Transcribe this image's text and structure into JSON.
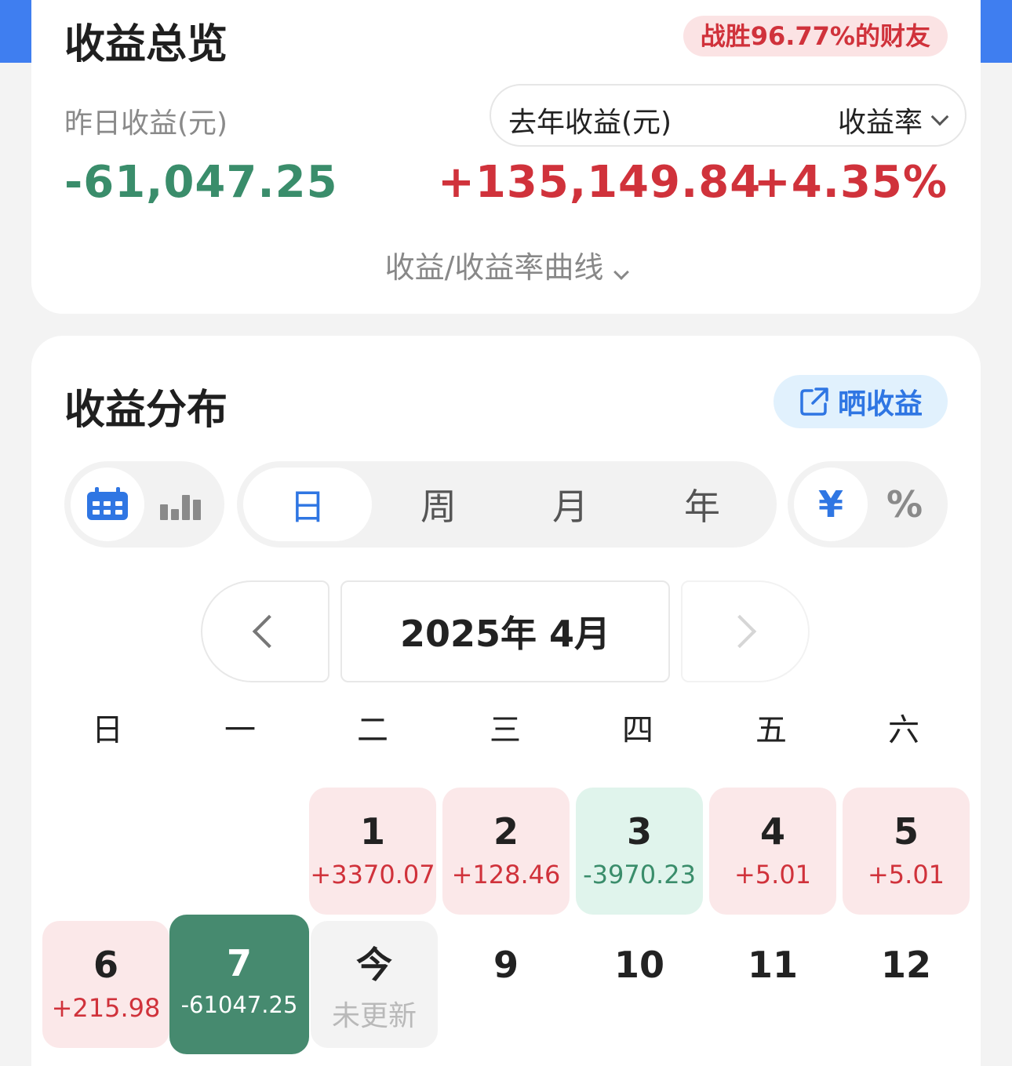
{
  "overview": {
    "title": "收益总览",
    "beat_badge": "战胜96.77%的财友",
    "yesterday_label": "昨日收益(元)",
    "yesterday_value": "-61,047.25",
    "last_year_label": "去年收益(元)",
    "rate_label": "收益率",
    "last_year_value": "+135,149.84",
    "rate_value": "+4.35%",
    "curve_link": "收益/收益率曲线"
  },
  "distribution": {
    "title": "收益分布",
    "share_label": "晒收益",
    "view_modes": [
      "calendar-icon",
      "bar-chart-icon"
    ],
    "periods": [
      "日",
      "周",
      "月",
      "年"
    ],
    "selected_period": "日",
    "units": [
      "¥",
      "%"
    ],
    "selected_unit": "¥",
    "month_label": "2025年 4月",
    "weekdays": [
      "日",
      "一",
      "二",
      "三",
      "四",
      "五",
      "六"
    ],
    "days": [
      {
        "day": "1",
        "value": "+3370.07",
        "type": "pos"
      },
      {
        "day": "2",
        "value": "+128.46",
        "type": "pos"
      },
      {
        "day": "3",
        "value": "-3970.23",
        "type": "neg"
      },
      {
        "day": "4",
        "value": "+5.01",
        "type": "pos"
      },
      {
        "day": "5",
        "value": "+5.01",
        "type": "pos"
      },
      {
        "day": "6",
        "value": "+215.98",
        "type": "pos"
      },
      {
        "day": "7",
        "value": "-61047.25",
        "type": "selected"
      },
      {
        "day": "今",
        "value": "未更新",
        "type": "today"
      },
      {
        "day": "9",
        "value": "",
        "type": "empty"
      },
      {
        "day": "10",
        "value": "",
        "type": "empty"
      },
      {
        "day": "11",
        "value": "",
        "type": "empty"
      },
      {
        "day": "12",
        "value": "",
        "type": "empty"
      }
    ]
  },
  "colors": {
    "accent": "#2f76e3",
    "gain": "#d0323b",
    "loss": "#3a8d6b",
    "selected_bg": "#468a6f"
  }
}
